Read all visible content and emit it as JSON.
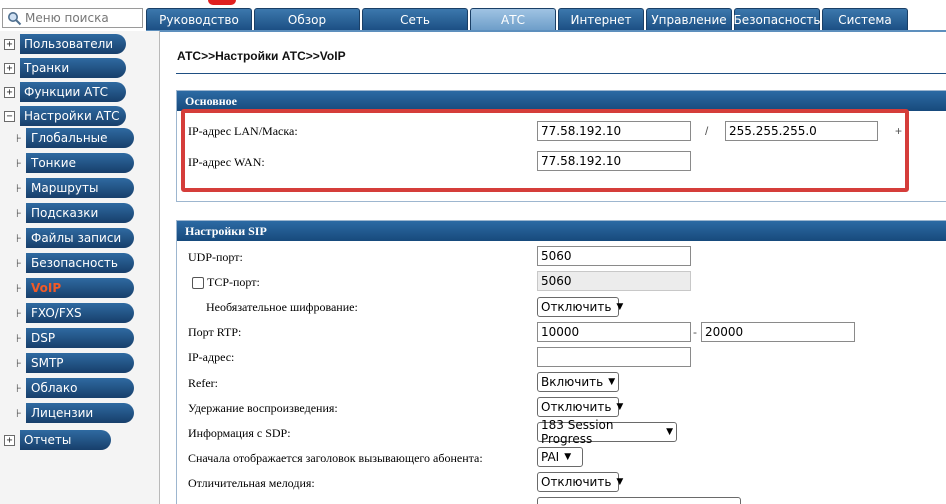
{
  "search": {
    "placeholder": "Меню поиска",
    "icon": "search-icon"
  },
  "tabs": [
    {
      "label": "Руководство",
      "active": false
    },
    {
      "label": "Обзор",
      "active": false
    },
    {
      "label": "Сеть",
      "active": false
    },
    {
      "label": "АТС",
      "active": true
    },
    {
      "label": "Интернет",
      "active": false
    },
    {
      "label": "Управление",
      "active": false
    },
    {
      "label": "Безопасность",
      "active": false
    },
    {
      "label": "Система",
      "active": false
    }
  ],
  "sidebar": {
    "users": {
      "sign": "⊞",
      "label": "Пользователи"
    },
    "trunks": {
      "sign": "⊞",
      "label": "Транки"
    },
    "pbx_functions": {
      "sign": "⊞",
      "label": "Функции АТС"
    },
    "pbx_settings": {
      "sign": "⊟",
      "label": "Настройки АТС"
    },
    "sub": [
      {
        "label": "Глобальные"
      },
      {
        "label": "Тонкие"
      },
      {
        "label": "Маршруты"
      },
      {
        "label": "Подсказки"
      },
      {
        "label": "Файлы записи"
      },
      {
        "label": "Безопасность"
      },
      {
        "label": "VoIP",
        "active": true
      },
      {
        "label": "FXO/FXS"
      },
      {
        "label": "DSP"
      },
      {
        "label": "SMTP"
      },
      {
        "label": "Облако"
      },
      {
        "label": "Лицензии"
      }
    ],
    "reports": {
      "sign": "⊞",
      "label": "Отчеты"
    }
  },
  "breadcrumb": "АТС>>Настройки АТС>>VoIP",
  "basic": {
    "title": "Основное",
    "lan_label": "IP-адрес LAN/Маска:",
    "lan_ip": "77.58.192.10",
    "slash": "/",
    "mask": "255.255.255.0",
    "plus": "+",
    "wan_label": "IP-адрес WAN:",
    "wan_ip": "77.58.192.10"
  },
  "sip": {
    "title": "Настройки SIP",
    "udp_label": "UDP-порт:",
    "udp_value": "5060",
    "tcp_label": "TCP-порт:",
    "tcp_value": "5060",
    "tcp_checked": false,
    "encryption_label": "Необязательное шифрование:",
    "encryption_value": "Отключить",
    "rtp_label": "Порт RTP:",
    "rtp_from": "10000",
    "rtp_dash": "-",
    "rtp_to": "20000",
    "ip_label": "IP-адрес:",
    "ip_value": "",
    "refer_label": "Refer:",
    "refer_value": "Включить",
    "hold_label": "Удержание воспроизведения:",
    "hold_value": "Отключить",
    "sdp_label": "Информация с SDP:",
    "sdp_value": "183 Session Progress",
    "caller_label": "Сначала отображается заголовок вызывающего абонента:",
    "caller_value": "PAI",
    "melody_label": "Отличительная мелодия:",
    "melody_value": "Отключить"
  },
  "colors": {
    "tab": "#1c4f84",
    "tab_active": "#8bb5da",
    "highlight": "#d53d3a",
    "active_menu": "#f05a28"
  }
}
